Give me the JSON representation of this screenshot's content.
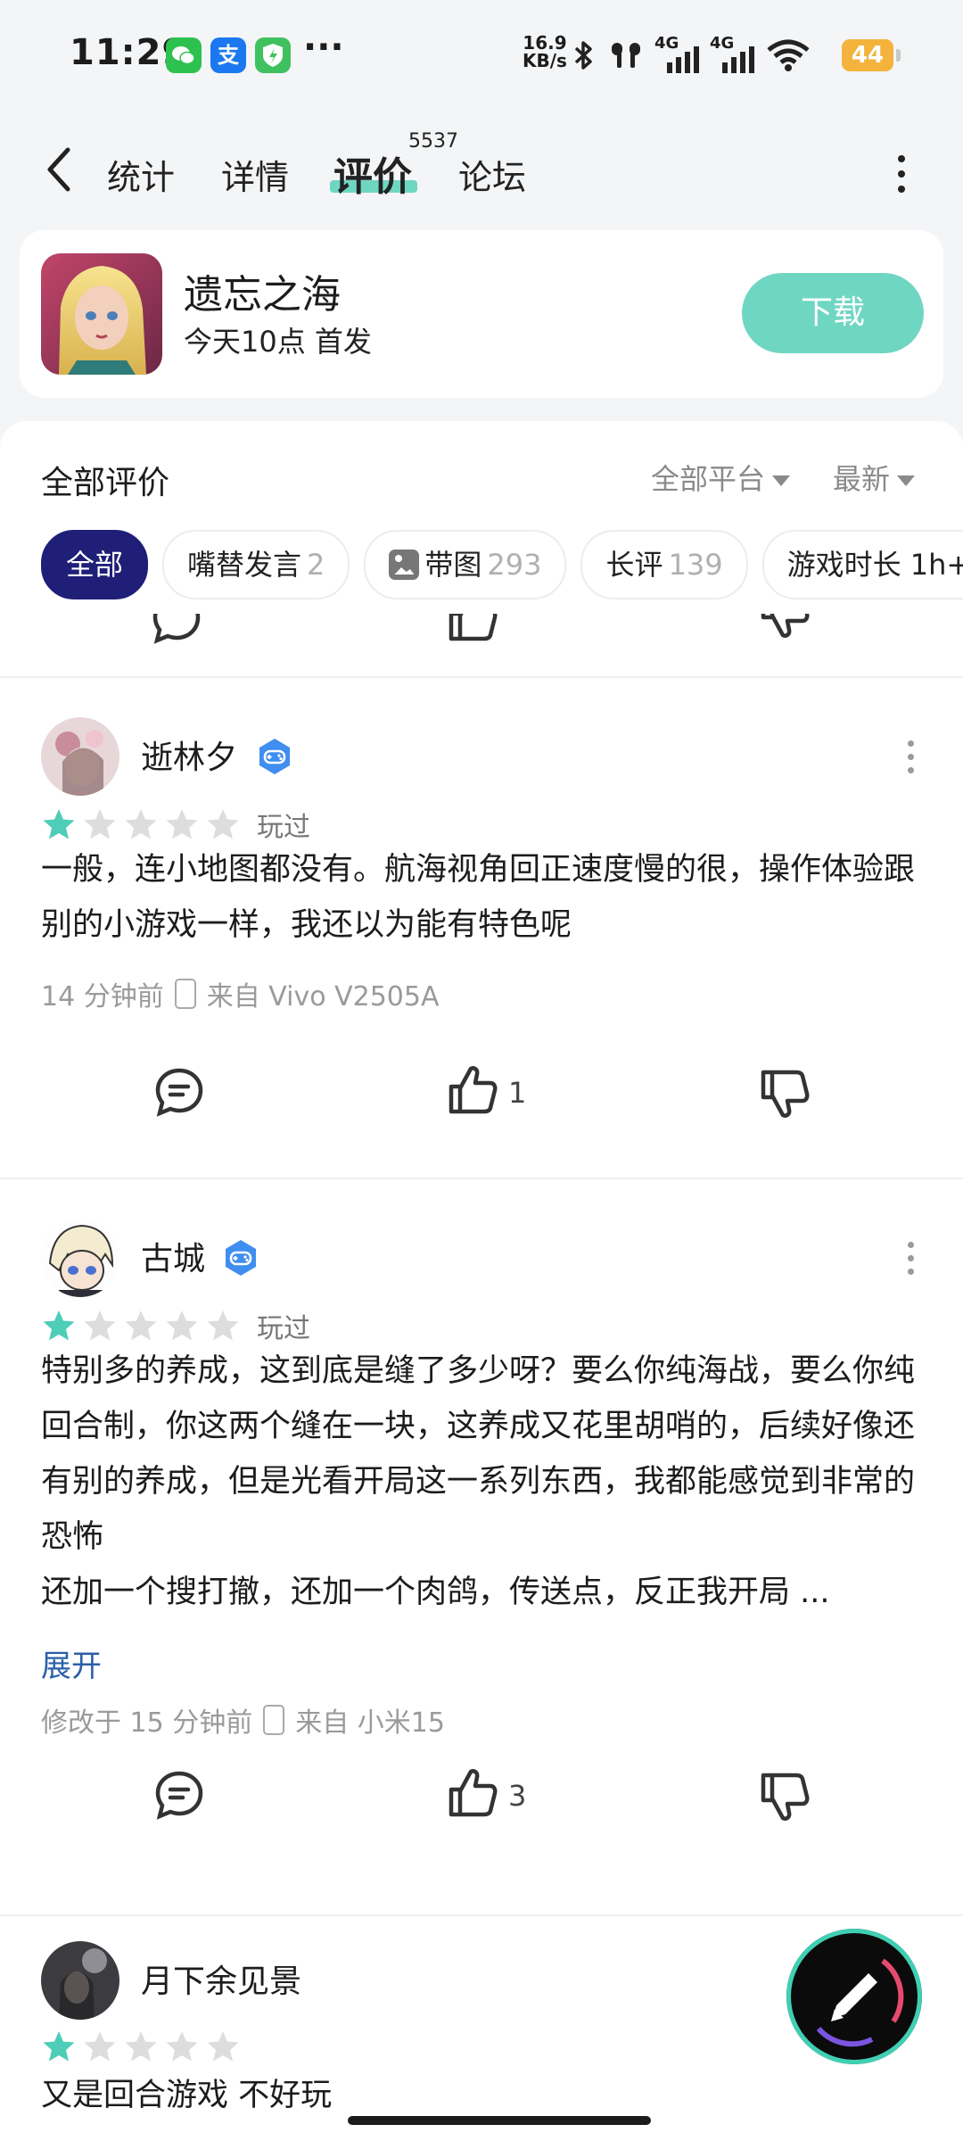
{
  "status_bar": {
    "time": "11:29",
    "dots": "···",
    "net_speed_value": "16.9",
    "net_speed_unit": "KB/s",
    "net_type_1": "4G",
    "net_type_2": "4G",
    "battery": "44",
    "apps": [
      "wechat-icon",
      "alipay-icon",
      "shield-app-icon"
    ],
    "alipay_glyph": "支"
  },
  "nav": {
    "tabs": [
      {
        "label": "统计"
      },
      {
        "label": "详情"
      },
      {
        "label": "评价"
      },
      {
        "label": "论坛"
      }
    ],
    "review_count": "5537",
    "accent": "#6fd6c2"
  },
  "game": {
    "name": "遗忘之海",
    "subtitle": "今天10点 首发",
    "download_label": "下载"
  },
  "reviews_panel": {
    "title": "全部评价",
    "platform_filter": "全部平台",
    "sort_filter": "最新",
    "chips": [
      {
        "label": "全部",
        "count": ""
      },
      {
        "label": "嘴替发言",
        "count": "2"
      },
      {
        "label": "带图",
        "count": "293"
      },
      {
        "label": "长评",
        "count": "139"
      },
      {
        "label": "游戏时长 1h+",
        "count": ""
      }
    ]
  },
  "reviews": [
    {
      "user": "逝林夕",
      "rating": 1,
      "max_rating": 5,
      "played": "玩过",
      "text": "一般，连小地图都没有。航海视角回正速度慢的很，操作体验跟别的小游戏一样，我还以为能有特色呢",
      "time": "14 分钟前",
      "device": "来自 Vivo V2505A",
      "likes": "1"
    },
    {
      "user": "古城",
      "rating": 1,
      "max_rating": 5,
      "played": "玩过",
      "text": "特别多的养成，这到底是缝了多少呀？要么你纯海战，要么你纯回合制，你这两个缝在一块，这养成又花里胡哨的，后续好像还有别的养成，但是光看开局这一系列东西，我都能感觉到非常的恐怖\n还加一个搜打撤，还加一个肉鸽，传送点，反正我开局 ...",
      "expand": "展开",
      "time": "修改于 15 分钟前",
      "device": "来自 小米15",
      "likes": "3"
    },
    {
      "user": "月下余见景",
      "rating": 1,
      "max_rating": 5,
      "text": "又是回合游戏 不好玩"
    }
  ],
  "colors": {
    "star_on": "#4ecdb8",
    "star_off": "#dddddd",
    "chip_active": "#1f1f78",
    "link": "#2b5fa8"
  }
}
